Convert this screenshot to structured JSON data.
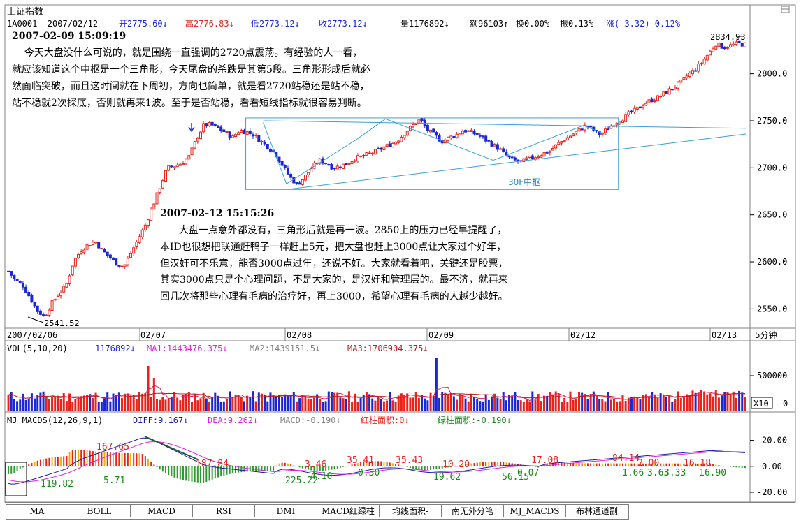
{
  "header": {
    "title": "上证指数",
    "code_date": "1A0001  2007/02/12",
    "open": "开2775.60↓",
    "high": "高2776.83↓",
    "low": "低2773.12↓",
    "close": "收2773.12↓",
    "volume": "量1176892↓",
    "amount": "额96103↑",
    "turnover": "换0.00%",
    "amplitude": "振0.13%",
    "change": "涨(-3.32)-0.12%"
  },
  "colors": {
    "up": "#e8231a",
    "down": "#1a27d6",
    "bg": "#ffffff",
    "grid": "#808080",
    "diff": "#1a1aaa",
    "dea": "#e020e0",
    "ma1": "#d81b60",
    "ma3": "#b71c1c",
    "trend": "#3aa0d8"
  },
  "annotations": {
    "note1_time": "2007-02-09 15:09:19",
    "note1_lines": [
      "    今天大盘没什么可说的，就是围绕一直强调的2720点震荡。有经验的人一看，",
      "就应该知道这个中枢是一个三角形，今天尾盘的杀跌是其第5段。三角形形成后就必",
      "然面临突破，而且这时间就在下周初，方向也简单，就是看2720站稳还是站不稳，",
      "站不稳就2次探底，否则就再来1波。至于是否站稳，看看短线指标就很容易判断。"
    ],
    "note2_time": "2007-02-12 15:15:26",
    "note2_lines": [
      "      大盘一点意外都没有，三角形后就是再一波。2850上的压力已经早提醒了，",
      "本ID也很想把联通赶鸭子一样赶上5元，把大盘也赶上3000点让大家过个好年，",
      "但汉奸可不乐意，能否3000点过年，还说不好。大家就看着吧，关键还是股票，",
      "其实3000点只是个心理问题，不是大家的，是汉奸和管理层的。最不济，就再来",
      "回几次将那些心理有毛病的治疗好，再上3000，希望心理有毛病的人越少越好。"
    ],
    "zhongshu_label": "30F中枢",
    "high_label": "2834.93",
    "low_label": "2541.52"
  },
  "x_axis": {
    "labels": [
      "2007/02/06",
      "02/07",
      "02/08",
      "02/09",
      "02/12",
      "02/13"
    ],
    "period": "5分钟"
  },
  "vol_header": {
    "name": "VOL(5,10,20)",
    "vol": "1176892↓",
    "ma1": "MA1:1443476.375↓",
    "ma2": "MA2:1439151.5↓",
    "ma3": "MA3:1706904.375↓",
    "scale": "X10"
  },
  "macd_header": {
    "name": "MJ_MACDS(12,26,9,1)",
    "diff": "DIFF:9.167↓",
    "dea": "DEA:9.262↓",
    "macd": "MACD:-0.190↓",
    "red_area": "红柱面积:0↓",
    "green_area": "绿柱面积:-0.190↓"
  },
  "macd_labels": [
    "119.82",
    "5.71",
    "167.65",
    "187.84",
    "225.22",
    "3.46",
    "4.10",
    "0.30",
    "35.41",
    "35.43",
    "19.62",
    "10.29",
    "56.15",
    "0.07",
    "17.08",
    "84.14",
    "1.66",
    "2.00",
    "3.63",
    "3.33",
    "16.18",
    "16.90"
  ],
  "tabs": [
    "MA",
    "BOLL",
    "MACD",
    "RSI",
    "DMI",
    "MACD红绿柱",
    "均线面积-",
    "南无外分笔",
    "MJ_MACDS",
    "布林通道副"
  ],
  "chart_data": [
    {
      "type": "candlestick",
      "title": "上证指数",
      "period": "5分钟",
      "y_ticks": [
        2550.0,
        2600.0,
        2650.0,
        2700.0,
        2750.0,
        2800.0
      ],
      "ylim": [
        2531,
        2845
      ],
      "x_date_labels": [
        "2007/02/06",
        "02/07",
        "02/08",
        "02/09",
        "02/12",
        "02/13"
      ],
      "marked_high": 2834.93,
      "marked_low": 2541.52,
      "close_path_approx": [
        2590,
        2580,
        2575,
        2562,
        2548,
        2542,
        2556,
        2566,
        2575,
        2600,
        2612,
        2618,
        2622,
        2612,
        2605,
        2598,
        2595,
        2610,
        2625,
        2640,
        2660,
        2680,
        2700,
        2702,
        2705,
        2712,
        2730,
        2745,
        2746,
        2742,
        2738,
        2732,
        2740,
        2738,
        2735,
        2728,
        2722,
        2715,
        2702,
        2690,
        2682,
        2690,
        2700,
        2708,
        2705,
        2700,
        2702,
        2705,
        2710,
        2712,
        2715,
        2718,
        2722,
        2725,
        2730,
        2738,
        2745,
        2752,
        2740,
        2735,
        2728,
        2732,
        2735,
        2740,
        2738,
        2735,
        2730,
        2725,
        2720,
        2712,
        2708,
        2706,
        2710,
        2712,
        2715,
        2718,
        2725,
        2730,
        2735,
        2740,
        2745,
        2740,
        2735,
        2742,
        2748,
        2752,
        2758,
        2762,
        2768,
        2772,
        2775,
        2780,
        2785,
        2790,
        2798,
        2804,
        2812,
        2822,
        2832,
        2828,
        2830,
        2832,
        2831
      ],
      "triangle_box": {
        "label": "30F中枢",
        "top": 2753,
        "bottom": 2677
      }
    },
    {
      "type": "bar",
      "title": "VOL(5,10,20)",
      "y_ticks": [
        500000
      ],
      "y_tick_labels": [
        "500000",
        "0"
      ],
      "scale": "X10",
      "series": [
        {
          "name": "VOL",
          "last": 1176892
        },
        {
          "name": "MA1",
          "last": 1443476.375
        },
        {
          "name": "MA2",
          "last": 1439151.5
        },
        {
          "name": "MA3",
          "last": 1706904.375
        }
      ]
    },
    {
      "type": "line",
      "title": "MJ_MACDS(12,26,9,1)",
      "y_ticks": [
        20.0,
        0.0,
        -20.0
      ],
      "ylim": [
        -27,
        30
      ],
      "series": [
        {
          "name": "DIFF",
          "last": 9.167
        },
        {
          "name": "DEA",
          "last": 9.262
        },
        {
          "name": "MACD",
          "last": -0.19
        }
      ],
      "red_area": 0,
      "green_area": -0.19
    }
  ]
}
